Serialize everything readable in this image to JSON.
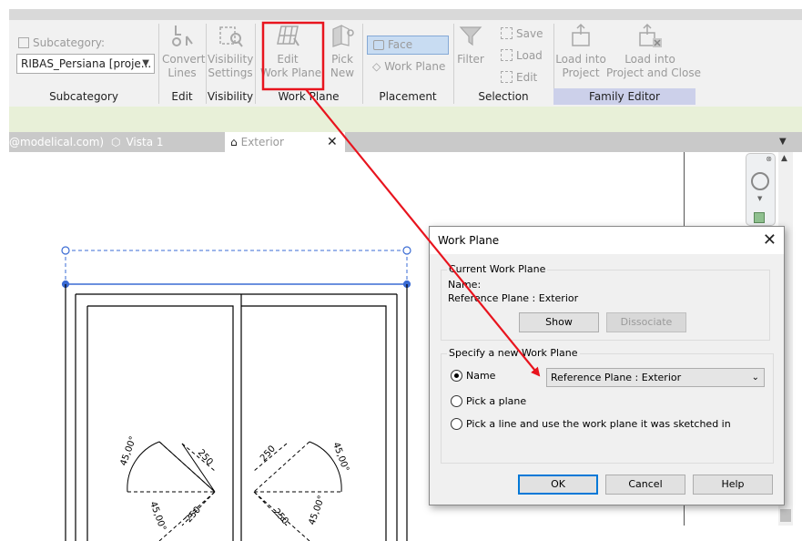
{
  "ribbon": {
    "subcategory": {
      "label": "Subcategory:",
      "selected": "RIBAS_Persiana [proje...",
      "panel_label": "Subcategory"
    },
    "edit": {
      "convert_lines": [
        "Convert",
        "Lines"
      ],
      "panel_label": "Edit"
    },
    "visibility": {
      "visibility_settings": [
        "Visibility",
        "Settings"
      ],
      "panel_label": "Visibility"
    },
    "work_plane": {
      "edit_work_plane": [
        "Edit",
        "Work Plane"
      ],
      "pick_new": [
        "Pick",
        "New"
      ],
      "panel_label": "Work Plane"
    },
    "placement": {
      "face": "Face",
      "work_plane": "Work Plane",
      "panel_label": "Placement"
    },
    "selection": {
      "filter": "Filter",
      "save": "Save",
      "load": "Load",
      "edit": "Edit",
      "panel_label": "Selection"
    },
    "family_editor": {
      "load_into_project": [
        "Load into",
        "Project"
      ],
      "load_into_project_close": [
        "Load into",
        "Project and Close"
      ],
      "panel_label": "Family Editor"
    }
  },
  "tabs": [
    {
      "label": "@modelical.com)"
    },
    {
      "label": "Vista 1"
    },
    {
      "label": "Exterior"
    }
  ],
  "dimensions": {
    "angle": "45,00°",
    "length": "250"
  },
  "dialog": {
    "title": "Work Plane",
    "current_group": "Current Work Plane",
    "name_label": "Name:",
    "current_name": "Reference Plane : Exterior",
    "show": "Show",
    "dissociate": "Dissociate",
    "specify_group": "Specify a new Work Plane",
    "option_name": "Name",
    "option_pick_plane": "Pick a plane",
    "option_pick_line": "Pick a line and use the work plane it was sketched in",
    "selected_plane": "Reference Plane : Exterior",
    "ok": "OK",
    "cancel": "Cancel",
    "help": "Help"
  },
  "colors": {
    "annotation_red": "#e8141e",
    "active_blue": "#0078d7"
  }
}
